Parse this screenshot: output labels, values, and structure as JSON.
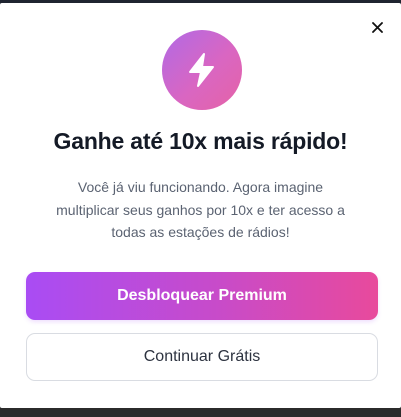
{
  "modal": {
    "close_icon": "close-icon",
    "badge_icon": "lightning-bolt-icon",
    "title": "Ganhe até 10x mais rápido!",
    "description_lines": [
      "Você já viu funcionando. Agora imagine",
      "multiplicar seus ganhos por 10x e ter acesso a",
      "todas as estações de rádios!"
    ],
    "primary_button": "Desbloquear Premium",
    "secondary_button": "Continuar Grátis"
  },
  "colors": {
    "gradient_start": "#a94cf4",
    "gradient_end": "#e84a9c",
    "title": "#141a26",
    "body_text": "#5b6372"
  }
}
